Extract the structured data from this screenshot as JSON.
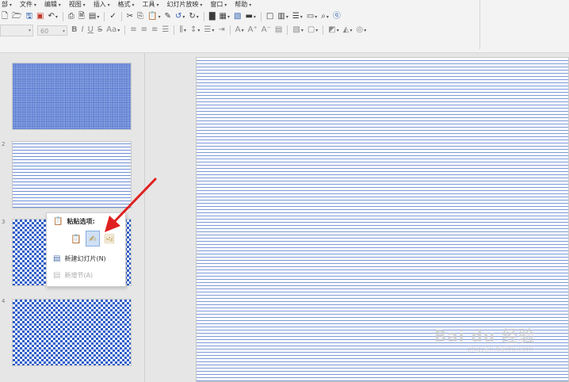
{
  "menubar": {
    "items": [
      "部",
      "文件",
      "编辑",
      "视图",
      "插入",
      "格式",
      "工具",
      "幻灯片放映",
      "窗口",
      "帮助"
    ]
  },
  "toolbar_row1": {
    "icons": [
      "new-icon",
      "open-icon",
      "save-icon",
      "pdf-icon",
      "undo-history-icon",
      "print-icon",
      "preview-icon",
      "copy-format-icon",
      "spellcheck-icon",
      "cut-icon",
      "copy-icon",
      "paste-icon",
      "brush-icon",
      "undo-icon",
      "redo-icon",
      "chart-icon",
      "table-icon",
      "image-icon",
      "display-icon",
      "layout-icon",
      "view-icon",
      "text-icon",
      "comment-icon",
      "zoom-icon",
      "help-icon"
    ]
  },
  "toolbar_row2": {
    "font_name": "",
    "font_size": "60",
    "format_labels": [
      "B",
      "I",
      "U",
      "S",
      "Aa"
    ]
  },
  "slides": [
    {
      "number": "",
      "fill": "dense"
    },
    {
      "number": "2",
      "fill": "lines"
    },
    {
      "number": "3",
      "fill": "check"
    },
    {
      "number": "4",
      "fill": "check"
    }
  ],
  "context_menu": {
    "paste_title": "粘贴选项:",
    "paste_options": [
      "keep-source-icon",
      "use-destination-icon",
      "picture-icon"
    ],
    "items": [
      {
        "label": "新建幻灯片(N)",
        "icon": "new-slide-icon",
        "enabled": true
      },
      {
        "label": "新增节(A)",
        "icon": "new-section-icon",
        "enabled": false
      }
    ]
  },
  "annotation": {
    "arrow_color": "#e02020"
  },
  "watermark": {
    "text": "Bai du 经验",
    "sub": "jingyan.baidu.com"
  },
  "colors": {
    "accent": "#2a5db0",
    "ribbon_bg": "#f3f3f3",
    "workspace_bg": "#e6e6e6"
  }
}
